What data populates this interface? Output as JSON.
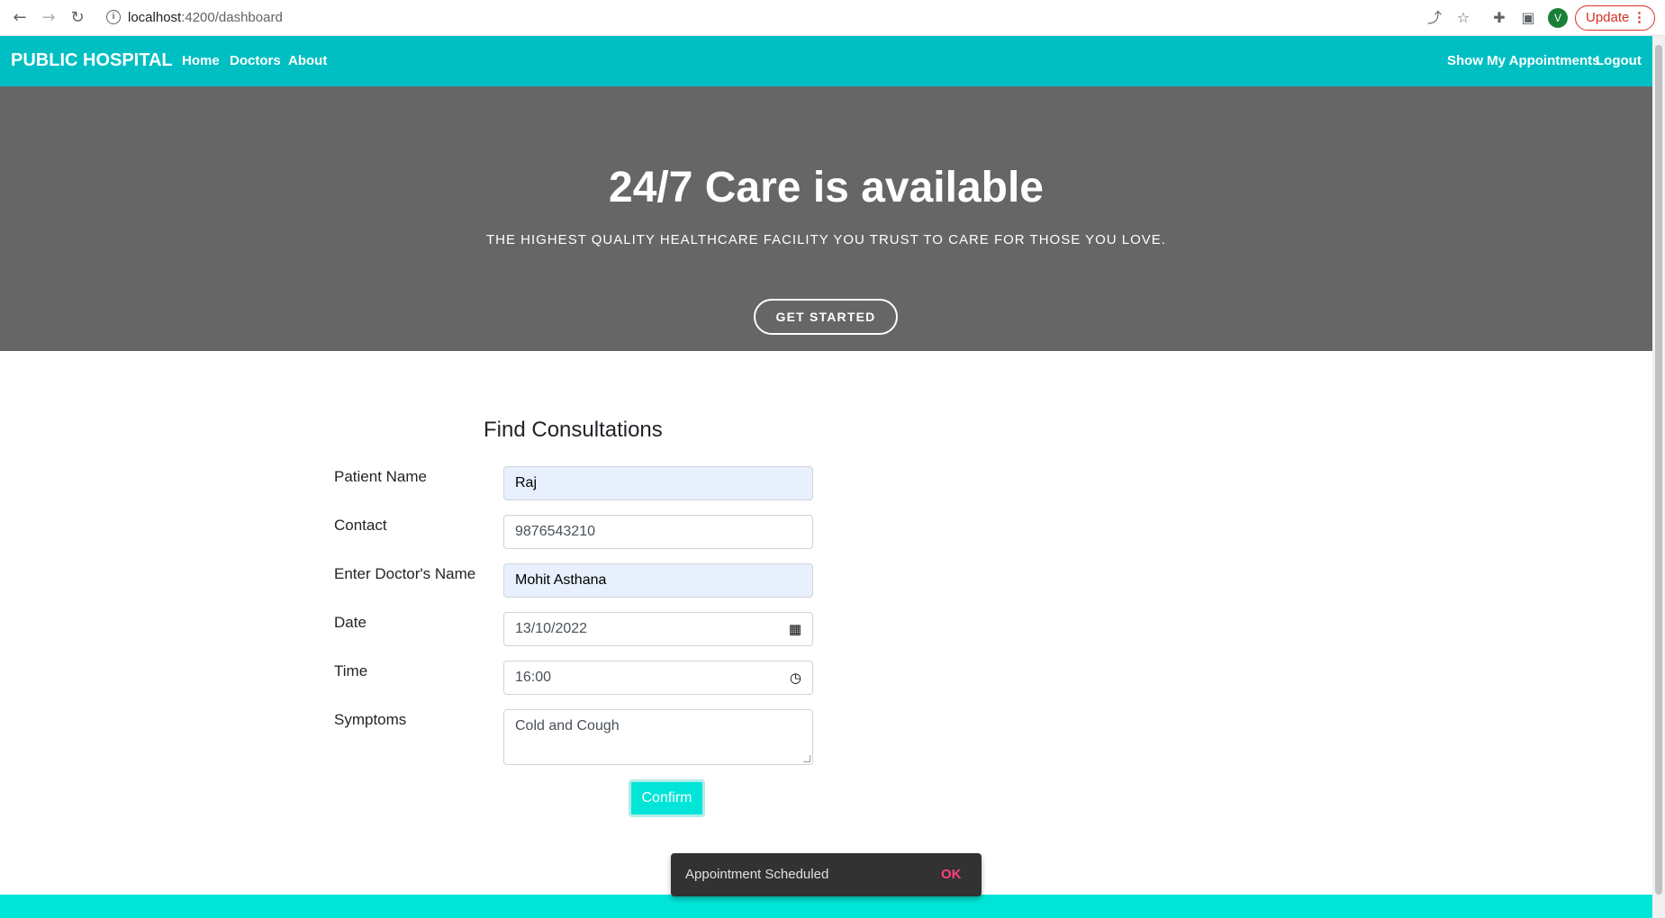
{
  "browser": {
    "url_host": "localhost",
    "url_path": ":4200/dashboard",
    "update_label": "Update",
    "avatar_letter": "V",
    "back_icon": "arrow-left-icon",
    "forward_icon": "arrow-right-icon",
    "reload_icon": "reload-icon"
  },
  "navbar": {
    "brand": "PUBLIC HOSPITAL",
    "links": [
      "Home",
      "Doctors",
      "About"
    ],
    "right_links": [
      "Show My Appointments",
      "Logout"
    ],
    "color": "#00bfc3"
  },
  "hero": {
    "title": "24/7 Care is available",
    "subtitle": "THE HIGHEST QUALITY HEALTHCARE FACILITY YOU TRUST TO CARE FOR THOSE YOU LOVE.",
    "cta": "GET STARTED",
    "background": "#666666"
  },
  "form": {
    "title": "Find Consultations",
    "fields": [
      {
        "label": "Patient Name",
        "value": "Raj"
      },
      {
        "label": "Contact",
        "value": "9876543210"
      },
      {
        "label": "Enter Doctor's Name",
        "value": "Mohit Asthana"
      },
      {
        "label": "Date",
        "value": "13/10/2022"
      },
      {
        "label": "Time",
        "value": "16:00"
      },
      {
        "label": "Symptoms",
        "value": "Cold and Cough"
      }
    ],
    "confirm": "Confirm"
  },
  "snackbar": {
    "message": "Appointment Scheduled",
    "action": "OK"
  }
}
